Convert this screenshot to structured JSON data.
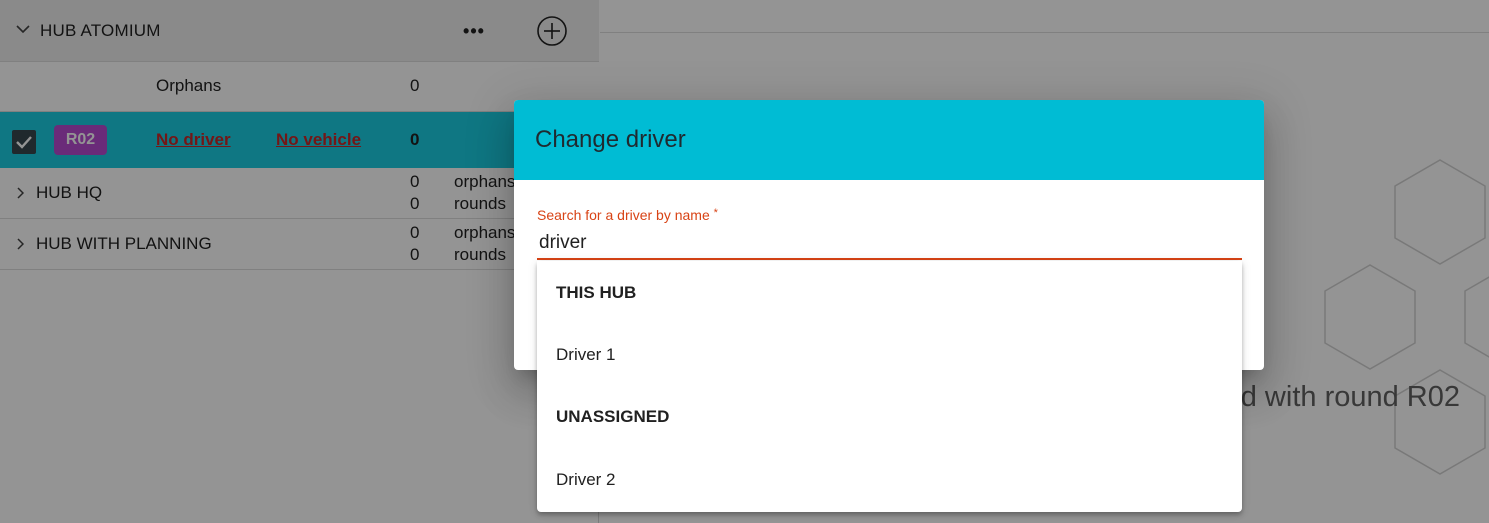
{
  "left": {
    "hub_header": {
      "title": "HUB ATOMIUM",
      "more_label": "•••"
    },
    "orphans_row": {
      "label": "Orphans",
      "count": "0"
    },
    "round_row": {
      "badge": "R02",
      "driver": "No driver",
      "vehicle": "No vehicle",
      "count": "0"
    },
    "hubs": [
      {
        "title": "HUB HQ",
        "orphans_count": "0",
        "orphans_word": "orphans",
        "rounds_count": "0",
        "rounds_word": "rounds"
      },
      {
        "title": "HUB WITH PLANNING",
        "orphans_count": "0",
        "orphans_word": "orphans",
        "rounds_count": "0",
        "rounds_word": "rounds"
      }
    ]
  },
  "right": {
    "empty_message": "d with round R02"
  },
  "dialog": {
    "title": "Change driver",
    "search": {
      "label": "Search for a driver by name",
      "required_mark": "*",
      "value": "driver"
    }
  },
  "autocomplete": {
    "groups": [
      {
        "label": "THIS HUB",
        "options": [
          "Driver 1"
        ]
      },
      {
        "label": "UNASSIGNED",
        "options": [
          "Driver 2"
        ]
      }
    ]
  },
  "colors": {
    "dialog_header": "#00bcd4",
    "selected_row": "#1bcee2",
    "round_badge": "#b74ad0",
    "warning_link": "#c62828",
    "field_accent": "#d84315"
  }
}
